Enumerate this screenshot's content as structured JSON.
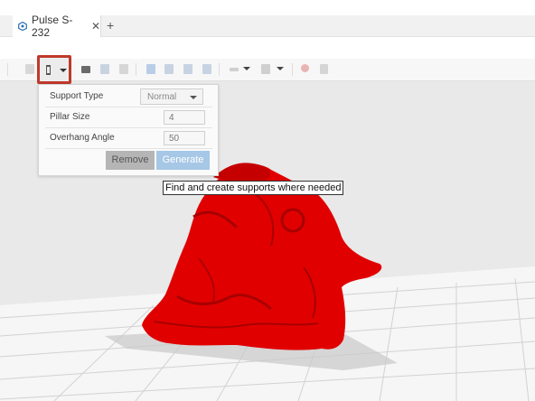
{
  "tab": {
    "title": "Pulse S-232",
    "close": "✕",
    "new_tab": "+"
  },
  "toolbar": {
    "icons": [
      "support-icon",
      "caret-down-icon",
      "grid-icon",
      "stack-icon",
      "align-icon",
      "copy-icon",
      "layer-icon",
      "cut-icon",
      "delete-icon",
      "path-icon",
      "light-icon",
      "color-icon",
      "move-icon"
    ]
  },
  "support_panel": {
    "support_type_label": "Support Type",
    "support_type_value": "Normal",
    "pillar_size_label": "Pillar Size",
    "pillar_size_value": "4",
    "overhang_angle_label": "Overhang Angle",
    "overhang_angle_value": "50",
    "remove_label": "Remove",
    "generate_label": "Generate"
  },
  "tooltip": {
    "text": "Find and create supports where needed"
  },
  "colors": {
    "model": "#e00000",
    "highlight": "#c0392b",
    "generate": "#a6c7e6"
  }
}
